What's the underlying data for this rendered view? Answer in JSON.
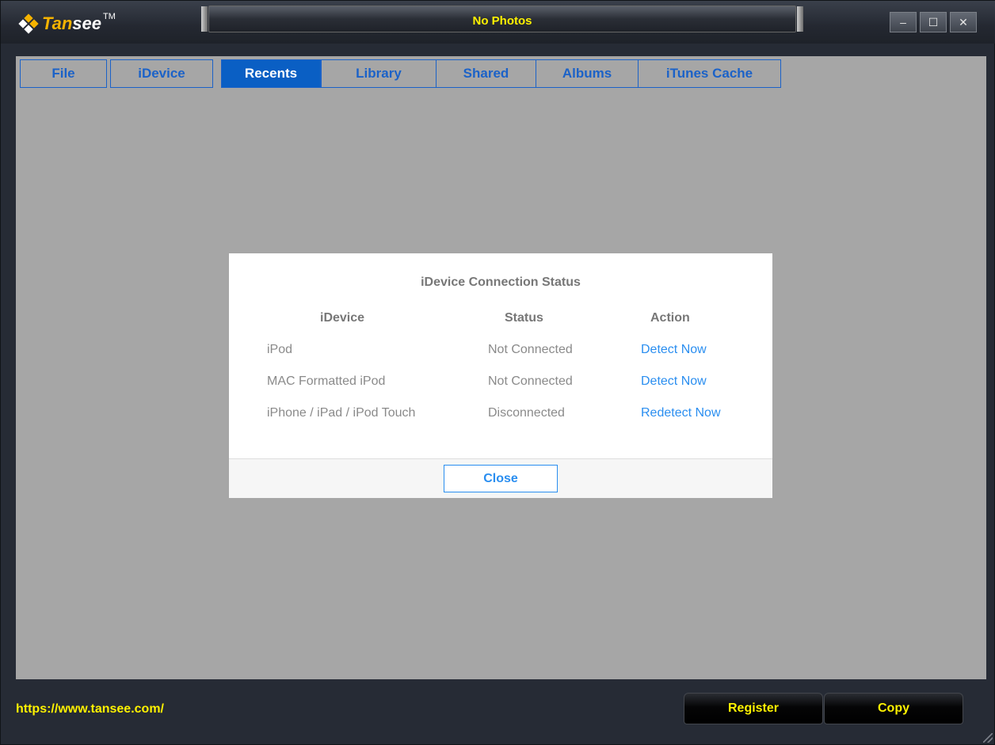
{
  "app": {
    "logo_text_a": "Tan",
    "logo_text_b": "see",
    "logo_tm": "TM",
    "window_title": "No Photos",
    "controls": {
      "minimize": "–",
      "maximize": "☐",
      "close": "✕"
    }
  },
  "tabs": [
    {
      "label": "File"
    },
    {
      "label": "iDevice"
    },
    {
      "label": "Recents",
      "active": true
    },
    {
      "label": "Library"
    },
    {
      "label": "Shared"
    },
    {
      "label": "Albums"
    },
    {
      "label": "iTunes Cache"
    }
  ],
  "dialog": {
    "title": "iDevice Connection Status",
    "headers": {
      "device": "iDevice",
      "status": "Status",
      "action": "Action"
    },
    "rows": [
      {
        "device": "iPod",
        "status": "Not Connected",
        "action": "Detect Now"
      },
      {
        "device": "MAC Formatted iPod",
        "status": "Not Connected",
        "action": "Detect Now"
      },
      {
        "device": "iPhone / iPad / iPod Touch",
        "status": "Disconnected",
        "action": "Redetect Now"
      }
    ],
    "close_label": "Close"
  },
  "footer": {
    "url": "https://www.tansee.com/",
    "register_label": "Register",
    "copy_label": "Copy"
  },
  "colors": {
    "accent_yellow": "#fff200",
    "tab_blue": "#1b62c8",
    "link_blue": "#2a8ef0",
    "content_gray": "#a6a6a6"
  }
}
